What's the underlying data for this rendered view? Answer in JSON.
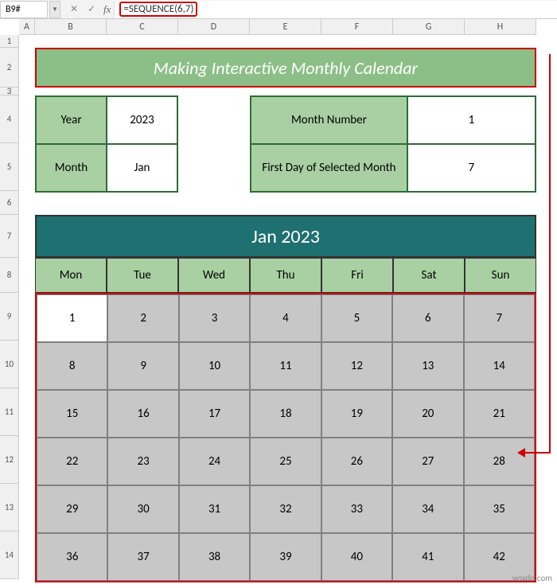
{
  "namebox": "B9#",
  "formula": "=SEQUENCE(6,7)",
  "columns": [
    "A",
    "B",
    "C",
    "D",
    "E",
    "F",
    "G",
    "H"
  ],
  "rows": [
    "1",
    "2",
    "3",
    "4",
    "5",
    "6",
    "7",
    "8",
    "9",
    "10",
    "11",
    "12",
    "13",
    "14"
  ],
  "title": "Making Interactive Monthly Calendar",
  "params1": {
    "year_lbl": "Year",
    "year_val": "2023",
    "month_lbl": "Month",
    "month_val": "Jan"
  },
  "params2": {
    "mn_lbl": "Month Number",
    "mn_val": "1",
    "fd_lbl": "First Day of Selected Month",
    "fd_val": "7"
  },
  "cal_title": "Jan 2023",
  "days": [
    "Mon",
    "Tue",
    "Wed",
    "Thu",
    "Fri",
    "Sat",
    "Sun"
  ],
  "chart_data": {
    "type": "table",
    "title": "Jan 2023",
    "columns": [
      "Mon",
      "Tue",
      "Wed",
      "Thu",
      "Fri",
      "Sat",
      "Sun"
    ],
    "rows": [
      [
        1,
        2,
        3,
        4,
        5,
        6,
        7
      ],
      [
        8,
        9,
        10,
        11,
        12,
        13,
        14
      ],
      [
        15,
        16,
        17,
        18,
        19,
        20,
        21
      ],
      [
        22,
        23,
        24,
        25,
        26,
        27,
        28
      ],
      [
        29,
        30,
        31,
        32,
        33,
        34,
        35
      ],
      [
        36,
        37,
        38,
        39,
        40,
        41,
        42
      ]
    ],
    "active_cell": [
      0,
      0
    ]
  },
  "watermark": "wsxdn.com"
}
